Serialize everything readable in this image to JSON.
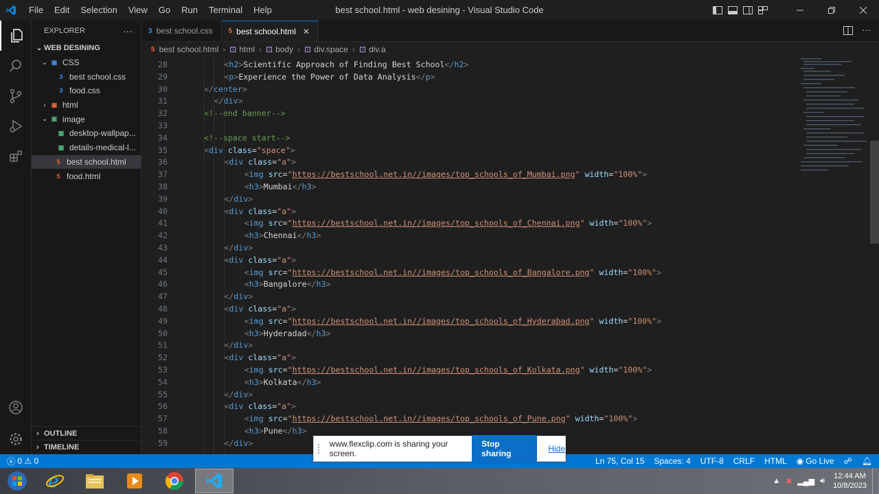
{
  "window": {
    "title": "best school.html - web desining - Visual Studio Code"
  },
  "menu": [
    "File",
    "Edit",
    "Selection",
    "View",
    "Go",
    "Run",
    "Terminal",
    "Help"
  ],
  "sidebar": {
    "header": "EXPLORER",
    "more": "···",
    "workspace": "WEB DESINING",
    "tree": [
      {
        "label": "CSS",
        "type": "folder",
        "open": true,
        "depth": 1
      },
      {
        "label": "best school.css",
        "type": "css",
        "depth": 2
      },
      {
        "label": "food.css",
        "type": "css",
        "depth": 2
      },
      {
        "label": "html",
        "type": "folder-html",
        "open": false,
        "depth": 1
      },
      {
        "label": "image",
        "type": "folder-image",
        "open": true,
        "depth": 1
      },
      {
        "label": "desktop-wallpap...",
        "type": "image",
        "depth": 2
      },
      {
        "label": "details-medical-l...",
        "type": "image",
        "depth": 2
      },
      {
        "label": "best school.html",
        "type": "html",
        "depth": 1,
        "selected": true
      },
      {
        "label": "food.html",
        "type": "html",
        "depth": 1
      }
    ],
    "outline": "OUTLINE",
    "timeline": "TIMELINE"
  },
  "tabs": [
    {
      "label": "best school.css",
      "type": "css",
      "active": false
    },
    {
      "label": "best school.html",
      "type": "html",
      "active": true,
      "close": "✕"
    }
  ],
  "breadcrumb": [
    "best school.html",
    "html",
    "body",
    "div.space",
    "div.a"
  ],
  "code": [
    {
      "n": "28",
      "indent": 2,
      "tokens": [
        [
          "t",
          "<"
        ],
        [
          "g",
          "h2"
        ],
        [
          "t",
          ">"
        ],
        [
          "x",
          "Scientific Approach of Finding Best School"
        ],
        [
          "t",
          "</"
        ],
        [
          "g",
          "h2"
        ],
        [
          "t",
          ">"
        ]
      ]
    },
    {
      "n": "29",
      "indent": 2,
      "tokens": [
        [
          "t",
          "<"
        ],
        [
          "g",
          "p"
        ],
        [
          "t",
          ">"
        ],
        [
          "x",
          "Experience the Power of Data Analysis"
        ],
        [
          "t",
          "</"
        ],
        [
          "g",
          "p"
        ],
        [
          "t",
          ">"
        ]
      ]
    },
    {
      "n": "30",
      "indent": 0,
      "tokens": [
        [
          "t",
          "</"
        ],
        [
          "g",
          "center"
        ],
        [
          "t",
          ">"
        ]
      ]
    },
    {
      "n": "31",
      "indent": 1,
      "tokens": [
        [
          "t",
          "</"
        ],
        [
          "g",
          "div"
        ],
        [
          "t",
          ">"
        ]
      ]
    },
    {
      "n": "32",
      "indent": 0,
      "tokens": [
        [
          "c",
          "<!--end banner-->"
        ]
      ]
    },
    {
      "n": "33",
      "indent": 0,
      "tokens": []
    },
    {
      "n": "34",
      "indent": 0,
      "tokens": [
        [
          "c",
          "<!--space start-->"
        ]
      ]
    },
    {
      "n": "35",
      "indent": 0,
      "tokens": [
        [
          "t",
          "<"
        ],
        [
          "g",
          "div"
        ],
        [
          "x",
          " "
        ],
        [
          "a",
          "class"
        ],
        [
          "x",
          "="
        ],
        [
          "s",
          "\"space\""
        ],
        [
          "t",
          ">"
        ]
      ]
    },
    {
      "n": "36",
      "indent": 2,
      "tokens": [
        [
          "t",
          "<"
        ],
        [
          "g",
          "div"
        ],
        [
          "x",
          " "
        ],
        [
          "a",
          "class"
        ],
        [
          "x",
          "="
        ],
        [
          "s",
          "\"a\""
        ],
        [
          "t",
          ">"
        ]
      ]
    },
    {
      "n": "37",
      "indent": 4,
      "tokens": [
        [
          "t",
          "<"
        ],
        [
          "g",
          "img"
        ],
        [
          "x",
          " "
        ],
        [
          "a",
          "src"
        ],
        [
          "x",
          "="
        ],
        [
          "s",
          "\""
        ],
        [
          "u",
          "https://bestschool.net.in//images/top_schools_of_Mumbai.png"
        ],
        [
          "s",
          "\""
        ],
        [
          "x",
          " "
        ],
        [
          "a",
          "width"
        ],
        [
          "x",
          "="
        ],
        [
          "s",
          "\"100%\""
        ],
        [
          "t",
          ">"
        ]
      ]
    },
    {
      "n": "38",
      "indent": 4,
      "tokens": [
        [
          "t",
          "<"
        ],
        [
          "g",
          "h3"
        ],
        [
          "t",
          ">"
        ],
        [
          "x",
          "Mumbai"
        ],
        [
          "t",
          "</"
        ],
        [
          "g",
          "h3"
        ],
        [
          "t",
          ">"
        ]
      ]
    },
    {
      "n": "39",
      "indent": 2,
      "tokens": [
        [
          "t",
          "</"
        ],
        [
          "g",
          "div"
        ],
        [
          "t",
          ">"
        ]
      ]
    },
    {
      "n": "40",
      "indent": 2,
      "tokens": [
        [
          "t",
          "<"
        ],
        [
          "g",
          "div"
        ],
        [
          "x",
          " "
        ],
        [
          "a",
          "class"
        ],
        [
          "x",
          "="
        ],
        [
          "s",
          "\"a\""
        ],
        [
          "t",
          ">"
        ]
      ]
    },
    {
      "n": "41",
      "indent": 4,
      "tokens": [
        [
          "t",
          "<"
        ],
        [
          "g",
          "img"
        ],
        [
          "x",
          " "
        ],
        [
          "a",
          "src"
        ],
        [
          "x",
          "="
        ],
        [
          "s",
          "\""
        ],
        [
          "u",
          "https://bestschool.net.in//images/top_schools_of_Chennai.png"
        ],
        [
          "s",
          "\""
        ],
        [
          "x",
          " "
        ],
        [
          "a",
          "width"
        ],
        [
          "x",
          "="
        ],
        [
          "s",
          "\"100%\""
        ],
        [
          "t",
          ">"
        ]
      ]
    },
    {
      "n": "42",
      "indent": 4,
      "tokens": [
        [
          "t",
          "<"
        ],
        [
          "g",
          "h3"
        ],
        [
          "t",
          ">"
        ],
        [
          "x",
          "Chennai"
        ],
        [
          "t",
          "</"
        ],
        [
          "g",
          "h3"
        ],
        [
          "t",
          ">"
        ]
      ]
    },
    {
      "n": "43",
      "indent": 2,
      "tokens": [
        [
          "t",
          "</"
        ],
        [
          "g",
          "div"
        ],
        [
          "t",
          ">"
        ]
      ]
    },
    {
      "n": "44",
      "indent": 2,
      "tokens": [
        [
          "t",
          "<"
        ],
        [
          "g",
          "div"
        ],
        [
          "x",
          " "
        ],
        [
          "a",
          "class"
        ],
        [
          "x",
          "="
        ],
        [
          "s",
          "\"a\""
        ],
        [
          "t",
          ">"
        ]
      ]
    },
    {
      "n": "45",
      "indent": 4,
      "tokens": [
        [
          "t",
          "<"
        ],
        [
          "g",
          "img"
        ],
        [
          "x",
          " "
        ],
        [
          "a",
          "src"
        ],
        [
          "x",
          "="
        ],
        [
          "s",
          "\""
        ],
        [
          "u",
          "https://bestschool.net.in//images/top_schools_of_Bangalore.png"
        ],
        [
          "s",
          "\""
        ],
        [
          "x",
          " "
        ],
        [
          "a",
          "width"
        ],
        [
          "x",
          "="
        ],
        [
          "s",
          "\"100%\""
        ],
        [
          "t",
          ">"
        ]
      ]
    },
    {
      "n": "46",
      "indent": 4,
      "tokens": [
        [
          "t",
          "<"
        ],
        [
          "g",
          "h3"
        ],
        [
          "t",
          ">"
        ],
        [
          "x",
          "Bangalore"
        ],
        [
          "t",
          "</"
        ],
        [
          "g",
          "h3"
        ],
        [
          "t",
          ">"
        ]
      ]
    },
    {
      "n": "47",
      "indent": 2,
      "tokens": [
        [
          "t",
          "</"
        ],
        [
          "g",
          "div"
        ],
        [
          "t",
          ">"
        ]
      ]
    },
    {
      "n": "48",
      "indent": 2,
      "tokens": [
        [
          "t",
          "<"
        ],
        [
          "g",
          "div"
        ],
        [
          "x",
          " "
        ],
        [
          "a",
          "class"
        ],
        [
          "x",
          "="
        ],
        [
          "s",
          "\"a\""
        ],
        [
          "t",
          ">"
        ]
      ]
    },
    {
      "n": "49",
      "indent": 4,
      "tokens": [
        [
          "t",
          "<"
        ],
        [
          "g",
          "img"
        ],
        [
          "x",
          " "
        ],
        [
          "a",
          "src"
        ],
        [
          "x",
          "="
        ],
        [
          "s",
          "\""
        ],
        [
          "u",
          "https://bestschool.net.in//images/top_schools_of_Hyderabad.png"
        ],
        [
          "s",
          "\""
        ],
        [
          "x",
          " "
        ],
        [
          "a",
          "width"
        ],
        [
          "x",
          "="
        ],
        [
          "s",
          "\"100%\""
        ],
        [
          "t",
          ">"
        ]
      ]
    },
    {
      "n": "50",
      "indent": 4,
      "tokens": [
        [
          "t",
          "<"
        ],
        [
          "g",
          "h3"
        ],
        [
          "t",
          ">"
        ],
        [
          "x",
          "Hyderadad"
        ],
        [
          "t",
          "</"
        ],
        [
          "g",
          "h3"
        ],
        [
          "t",
          ">"
        ]
      ]
    },
    {
      "n": "51",
      "indent": 2,
      "tokens": [
        [
          "t",
          "</"
        ],
        [
          "g",
          "div"
        ],
        [
          "t",
          ">"
        ]
      ]
    },
    {
      "n": "52",
      "indent": 2,
      "tokens": [
        [
          "t",
          "<"
        ],
        [
          "g",
          "div"
        ],
        [
          "x",
          " "
        ],
        [
          "a",
          "class"
        ],
        [
          "x",
          "="
        ],
        [
          "s",
          "\"a\""
        ],
        [
          "t",
          ">"
        ]
      ]
    },
    {
      "n": "53",
      "indent": 4,
      "tokens": [
        [
          "t",
          "<"
        ],
        [
          "g",
          "img"
        ],
        [
          "x",
          " "
        ],
        [
          "a",
          "src"
        ],
        [
          "x",
          "="
        ],
        [
          "s",
          "\""
        ],
        [
          "u",
          "https://bestschool.net.in//images/top_schools_of_Kolkata.png"
        ],
        [
          "s",
          "\""
        ],
        [
          "x",
          " "
        ],
        [
          "a",
          "width"
        ],
        [
          "x",
          "="
        ],
        [
          "s",
          "\"100%\""
        ],
        [
          "t",
          ">"
        ]
      ]
    },
    {
      "n": "54",
      "indent": 4,
      "tokens": [
        [
          "t",
          "<"
        ],
        [
          "g",
          "h3"
        ],
        [
          "t",
          ">"
        ],
        [
          "x",
          "Kolkata"
        ],
        [
          "t",
          "</"
        ],
        [
          "g",
          "h3"
        ],
        [
          "t",
          ">"
        ]
      ]
    },
    {
      "n": "55",
      "indent": 2,
      "tokens": [
        [
          "t",
          "</"
        ],
        [
          "g",
          "div"
        ],
        [
          "t",
          ">"
        ]
      ]
    },
    {
      "n": "56",
      "indent": 2,
      "tokens": [
        [
          "t",
          "<"
        ],
        [
          "g",
          "div"
        ],
        [
          "x",
          " "
        ],
        [
          "a",
          "class"
        ],
        [
          "x",
          "="
        ],
        [
          "s",
          "\"a\""
        ],
        [
          "t",
          ">"
        ]
      ]
    },
    {
      "n": "57",
      "indent": 4,
      "tokens": [
        [
          "t",
          "<"
        ],
        [
          "g",
          "img"
        ],
        [
          "x",
          " "
        ],
        [
          "a",
          "src"
        ],
        [
          "x",
          "="
        ],
        [
          "s",
          "\""
        ],
        [
          "u",
          "https://bestschool.net.in//images/top_schools_of_Pune.png"
        ],
        [
          "s",
          "\""
        ],
        [
          "x",
          " "
        ],
        [
          "a",
          "width"
        ],
        [
          "x",
          "="
        ],
        [
          "s",
          "\"100%\""
        ],
        [
          "t",
          ">"
        ]
      ]
    },
    {
      "n": "58",
      "indent": 4,
      "tokens": [
        [
          "t",
          "<"
        ],
        [
          "g",
          "h3"
        ],
        [
          "t",
          ">"
        ],
        [
          "x",
          "Pune"
        ],
        [
          "t",
          "</"
        ],
        [
          "g",
          "h3"
        ],
        [
          "t",
          ">"
        ]
      ]
    },
    {
      "n": "59",
      "indent": 2,
      "tokens": [
        [
          "t",
          "</"
        ],
        [
          "g",
          "div"
        ],
        [
          "t",
          ">"
        ]
      ]
    }
  ],
  "statusbar": {
    "problems": "0",
    "warnings": "0",
    "cursor": "Ln 75, Col 15",
    "spaces": "Spaces: 4",
    "encoding": "UTF-8",
    "eol": "CRLF",
    "language": "HTML",
    "golive": "Go Live"
  },
  "sharebar": {
    "message": "www.flexclip.com is sharing your screen.",
    "stop": "Stop sharing",
    "hide": "Hide"
  },
  "taskbar": {
    "time": "12:44 AM",
    "date": "10/8/2023",
    "apps": [
      "start-button",
      "internet-explorer-icon",
      "file-explorer-icon",
      "media-player-icon",
      "chrome-icon",
      "vscode-icon"
    ]
  },
  "colors": {
    "accent": "#0078d4",
    "statusbar": "#0078d4",
    "tag": "#569cd6",
    "attr": "#9cdcfe",
    "string": "#ce9178",
    "comment": "#6a9955"
  }
}
